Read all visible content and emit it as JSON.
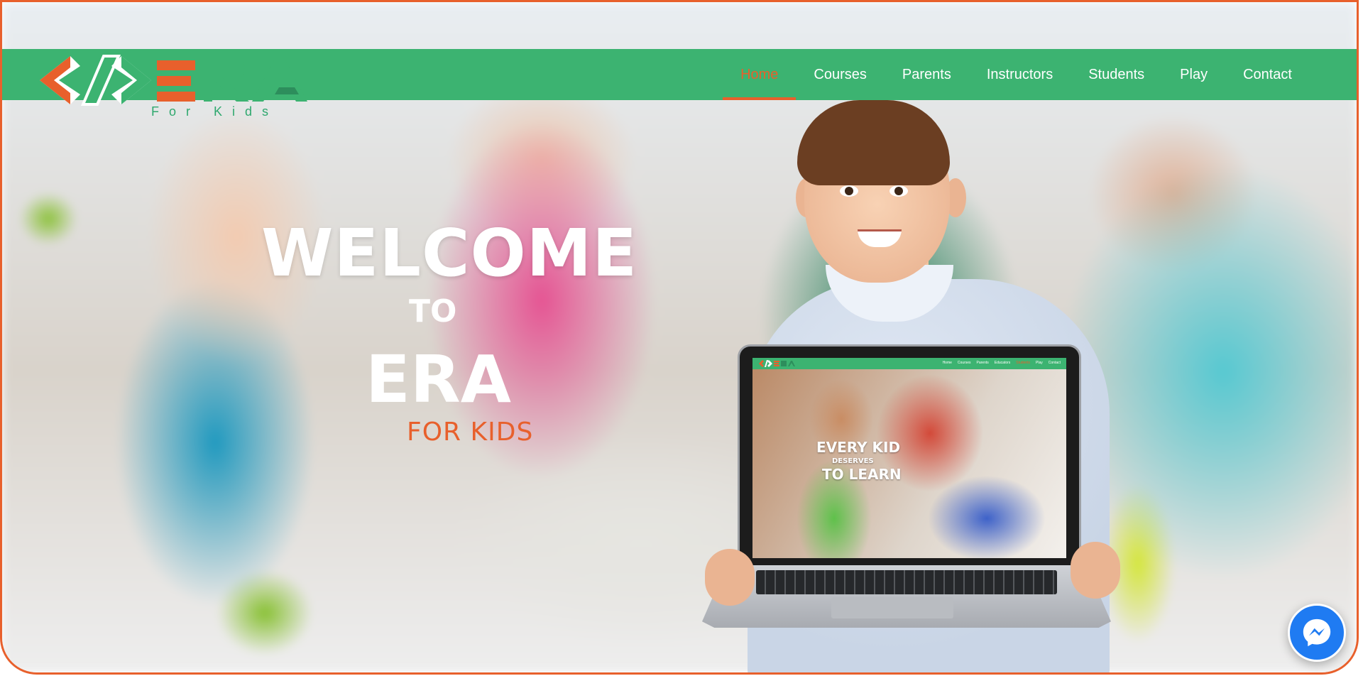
{
  "brand": {
    "logo_letters": "ERA",
    "logo_tagline": "For Kids",
    "logo_icon": "code-brackets-icon"
  },
  "nav": {
    "items": [
      {
        "label": "Home",
        "active": true
      },
      {
        "label": "Courses",
        "active": false
      },
      {
        "label": "Parents",
        "active": false
      },
      {
        "label": "Instructors",
        "active": false
      },
      {
        "label": "Students",
        "active": false
      },
      {
        "label": "Play",
        "active": false
      },
      {
        "label": "Contact",
        "active": false
      }
    ]
  },
  "hero": {
    "line1": "WELCOME",
    "line2": "TO",
    "line3": "ERA",
    "line4": "FOR KIDS"
  },
  "laptop_preview": {
    "nav_items": [
      "Home",
      "Courses",
      "Parents",
      "Educators",
      "Students",
      "Play",
      "Contact"
    ],
    "active_item": "Students",
    "headline1": "EVERY KID",
    "headline2": "DESERVES",
    "headline3": "TO LEARN"
  },
  "floating": {
    "messenger_icon": "messenger-icon"
  },
  "colors": {
    "nav_green": "#3cb371",
    "accent_orange": "#e8602c",
    "messenger_blue": "#1f7bf2"
  }
}
